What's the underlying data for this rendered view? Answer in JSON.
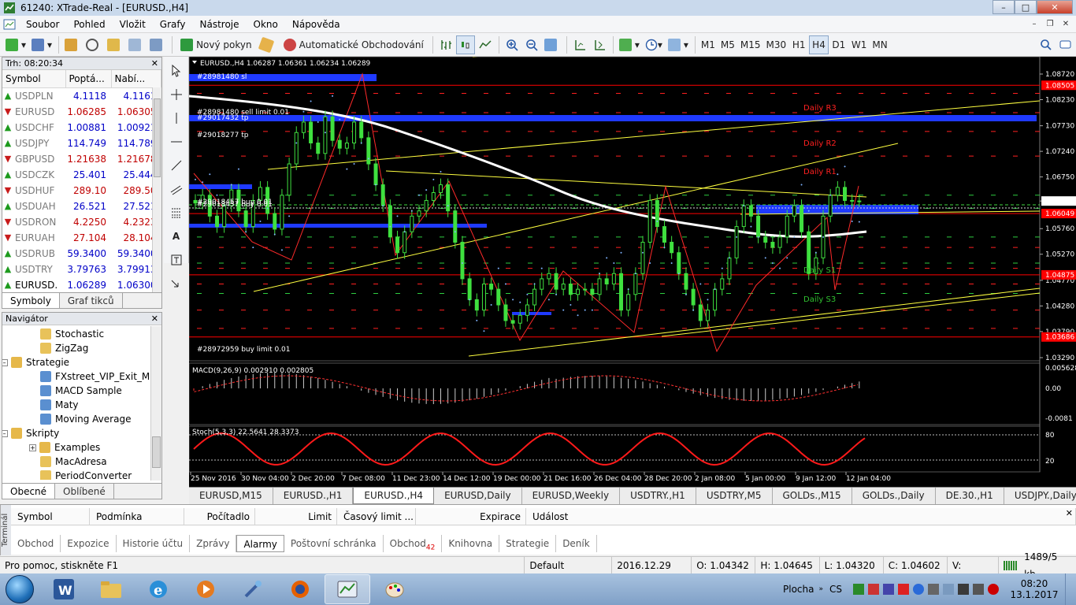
{
  "window": {
    "title": "61240: XTrade-Real - [EURUSD.,H4]"
  },
  "menu": [
    "Soubor",
    "Pohled",
    "Vložit",
    "Grafy",
    "Nástroje",
    "Okno",
    "Nápověda"
  ],
  "toolbar": {
    "new_order": "Nový pokyn",
    "auto_trading": "Automatické Obchodování",
    "periods": [
      "M1",
      "M5",
      "M15",
      "M30",
      "H1",
      "H4",
      "D1",
      "W1",
      "MN"
    ],
    "active_period": "H4"
  },
  "market_watch": {
    "header": "Trh: 08:20:34",
    "columns": [
      "Symbol",
      "Poptá...",
      "Nabí..."
    ],
    "rows": [
      {
        "symbol": "USDPLN",
        "bid": "4.1118",
        "ask": "4.1161",
        "dir": "up"
      },
      {
        "symbol": "EURUSD",
        "bid": "1.06285",
        "ask": "1.06305",
        "dir": "dn"
      },
      {
        "symbol": "USDCHF",
        "bid": "1.00881",
        "ask": "1.00921",
        "dir": "up"
      },
      {
        "symbol": "USDJPY",
        "bid": "114.749",
        "ask": "114.789",
        "dir": "up"
      },
      {
        "symbol": "GBPUSD",
        "bid": "1.21638",
        "ask": "1.21678",
        "dir": "dn"
      },
      {
        "symbol": "USDCZK",
        "bid": "25.401",
        "ask": "25.444",
        "dir": "up"
      },
      {
        "symbol": "USDHUF",
        "bid": "289.10",
        "ask": "289.50",
        "dir": "dn"
      },
      {
        "symbol": "USDUAH",
        "bid": "26.521",
        "ask": "27.521",
        "dir": "up"
      },
      {
        "symbol": "USDRON",
        "bid": "4.2250",
        "ask": "4.2323",
        "dir": "dn"
      },
      {
        "symbol": "EURUAH",
        "bid": "27.104",
        "ask": "28.104",
        "dir": "dn"
      },
      {
        "symbol": "USDRUB",
        "bid": "59.3400",
        "ask": "59.3400",
        "dir": "up"
      },
      {
        "symbol": "USDTRY",
        "bid": "3.79763",
        "ask": "3.79913",
        "dir": "up"
      },
      {
        "symbol": "EURUSD.",
        "bid": "1.06289",
        "ask": "1.06300",
        "dir": "up"
      }
    ],
    "tabs": [
      "Symboly",
      "Graf tikců"
    ]
  },
  "navigator": {
    "header": "Navigátor",
    "items": [
      {
        "label": "Stochastic",
        "level": 2,
        "kind": "ind"
      },
      {
        "label": "ZigZag",
        "level": 2,
        "kind": "ind"
      },
      {
        "label": "Strategie",
        "level": 1,
        "kind": "folder"
      },
      {
        "label": "FXstreet_VIP_Exit_Mar",
        "level": 2,
        "kind": "ea"
      },
      {
        "label": "MACD Sample",
        "level": 2,
        "kind": "ea"
      },
      {
        "label": "Maty",
        "level": 2,
        "kind": "ea"
      },
      {
        "label": "Moving Average",
        "level": 2,
        "kind": "ea"
      },
      {
        "label": "Skripty",
        "level": 1,
        "kind": "folder"
      },
      {
        "label": "Examples",
        "level": 2,
        "kind": "folder"
      },
      {
        "label": "MacAdresa",
        "level": 2,
        "kind": "ind"
      },
      {
        "label": "PeriodConverter",
        "level": 2,
        "kind": "ind"
      }
    ],
    "tabs": [
      "Obecné",
      "Oblíbené"
    ]
  },
  "chart": {
    "header": "EURUSD.,H4  1.06287 1.06361 1.06234 1.06289",
    "price_labels": [
      "1.08720",
      "1.08230",
      "1.07730",
      "1.07240",
      "1.06750",
      "1.06289",
      "1.05760",
      "1.05270",
      "1.04770",
      "1.04280",
      "1.03790",
      "1.03290"
    ],
    "highlight_prices": [
      {
        "label": "1.08505",
        "color": "#ff0000"
      },
      {
        "label": "1.06049",
        "color": "#ff0000"
      },
      {
        "label": "1.04875",
        "color": "#ff0000"
      },
      {
        "label": "1.03686",
        "color": "#ff0000"
      }
    ],
    "time_labels": [
      "25 Nov 2016",
      "30 Nov 04:00",
      "2 Dec 20:00",
      "7 Dec 08:00",
      "11 Dec 23:00",
      "14 Dec 12:00",
      "19 Dec 00:00",
      "21 Dec 16:00",
      "26 Dec 04:00",
      "28 Dec 20:00",
      "2 Jan 08:00",
      "5 Jan 00:00",
      "9 Jan 12:00",
      "12 Jan 04:00"
    ],
    "order_labels": [
      "#28981480 sl",
      "#28981480 sell limit 0.01",
      "#29017432 tp",
      "#29018277 tp",
      "#28972959 buy limit 0.01",
      "#29018457 buy 0.01"
    ],
    "pivot_labels": [
      {
        "label": "Daily R3",
        "color": "#ff2020"
      },
      {
        "label": "Daily R2",
        "color": "#ff2020"
      },
      {
        "label": "Daily R1",
        "color": "#ff2020"
      },
      {
        "label": "Daily S1",
        "color": "#30c030"
      },
      {
        "label": "Daily S3",
        "color": "#30c030"
      }
    ],
    "macd": {
      "label": "MACD(9,26,9) 0.002910 0.002805",
      "levels": [
        "0.005628",
        "0.00",
        "-0.0081"
      ]
    },
    "stoch": {
      "label": "Stoch(5,3,3) 22.5641 28.3373",
      "levels": [
        "80",
        "20"
      ]
    }
  },
  "chart_tabs": [
    "EURUSD,M15",
    "EURUSD.,H1",
    "EURUSD.,H4",
    "EURUSD,Daily",
    "EURUSD,Weekly",
    "USDTRY.,H1",
    "USDTRY,M5",
    "GOLDs.,M15",
    "GOLDs.,Daily",
    "DE.30.,H1",
    "USDJPY.,Daily",
    "USDJPY.,H1"
  ],
  "active_chart_tab": "EURUSD.,H4",
  "terminal": {
    "side_label": "Terminál",
    "columns": [
      "Symbol",
      "Podmínka",
      "Počítadlo",
      "Limit",
      "Časový limit ...",
      "Expirace",
      "Událost"
    ],
    "tabs": [
      "Obchod",
      "Expozice",
      "Historie účtu",
      "Zprávy",
      "Alarmy",
      "Poštovní schránka",
      "Obchod",
      "Knihovna",
      "Strategie",
      "Deník"
    ],
    "active_tab": "Alarmy",
    "badge": "42"
  },
  "status": {
    "help": "Pro pomoc, stiskněte F1",
    "profile": "Default",
    "datetime": "2016.12.29 04:00",
    "open": "O: 1.04342",
    "high": "H: 1.04645",
    "low": "L: 1.04320",
    "close": "C: 1.04602",
    "volume": "V: 11902",
    "traffic": "1489/5 kb"
  },
  "taskbar": {
    "desktop_label": "Plocha",
    "lang": "CS",
    "time": "08:20",
    "date": "13.1.2017"
  }
}
